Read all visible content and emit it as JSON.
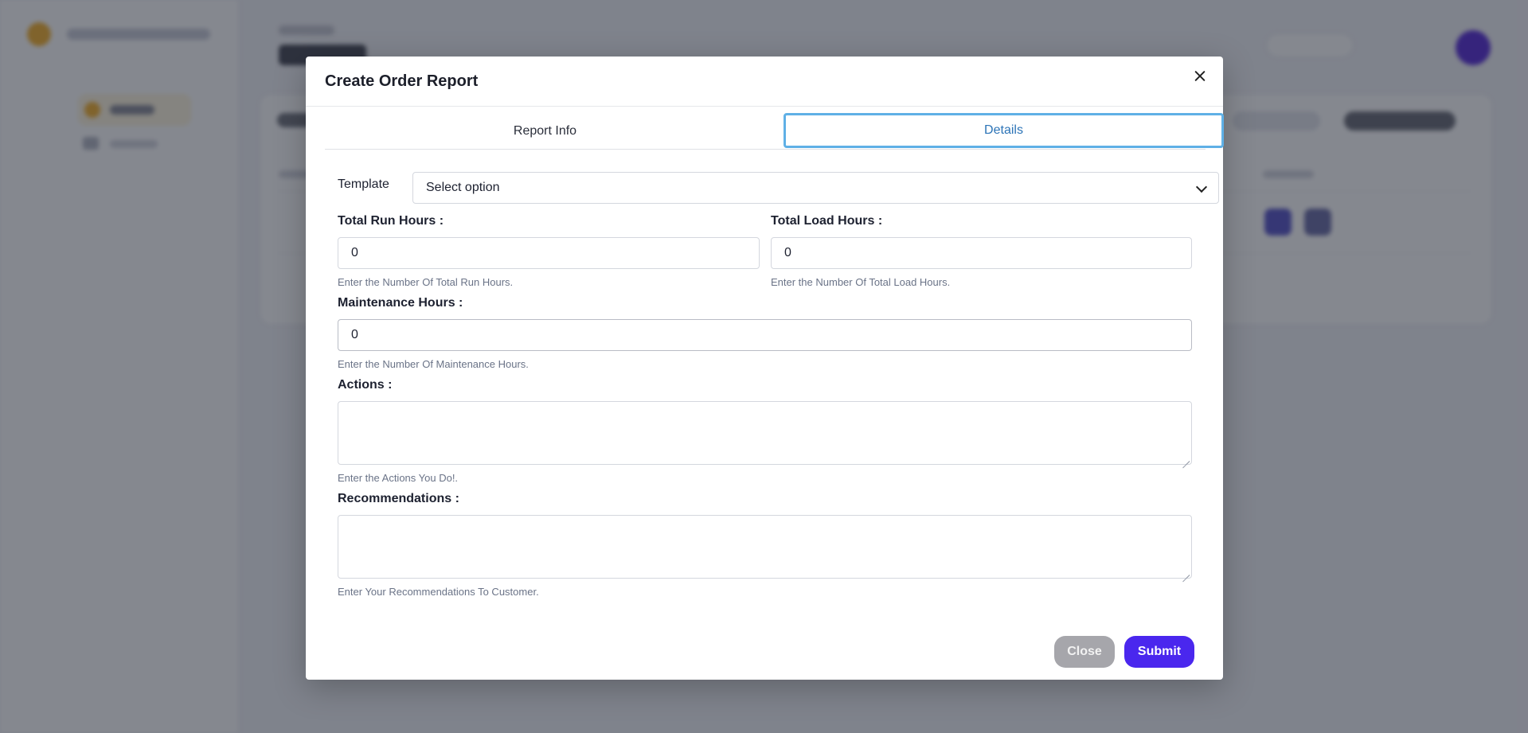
{
  "modal": {
    "title": "Create Order Report",
    "tabs": [
      {
        "label": "Report Info",
        "active": false
      },
      {
        "label": "Details",
        "active": true
      }
    ]
  },
  "form": {
    "template": {
      "label": "Template",
      "value": "Select option"
    },
    "total_run_hours": {
      "label": "Total Run Hours :",
      "value": "0",
      "help": "Enter the Number Of Total Run Hours."
    },
    "total_load_hours": {
      "label": "Total Load Hours :",
      "value": "0",
      "help": "Enter the Number Of Total Load Hours."
    },
    "maintenance_hours": {
      "label": "Maintenance Hours :",
      "value": "0",
      "help": "Enter the Number Of Maintenance Hours."
    },
    "actions": {
      "label": "Actions :",
      "value": "",
      "help": "Enter the Actions You Do!."
    },
    "recommendations": {
      "label": "Recommendations :",
      "value": "",
      "help": "Enter Your Recommendations To Customer."
    }
  },
  "footer": {
    "close_label": "Close",
    "submit_label": "Submit"
  },
  "colors": {
    "accent": "#4a27ee",
    "active_tab_border": "#5fb0e6",
    "active_tab_text": "#2c74b7",
    "close_button": "#a6a6ab"
  },
  "icons": {
    "close": "close-icon",
    "select": "chevron-down-icon"
  }
}
